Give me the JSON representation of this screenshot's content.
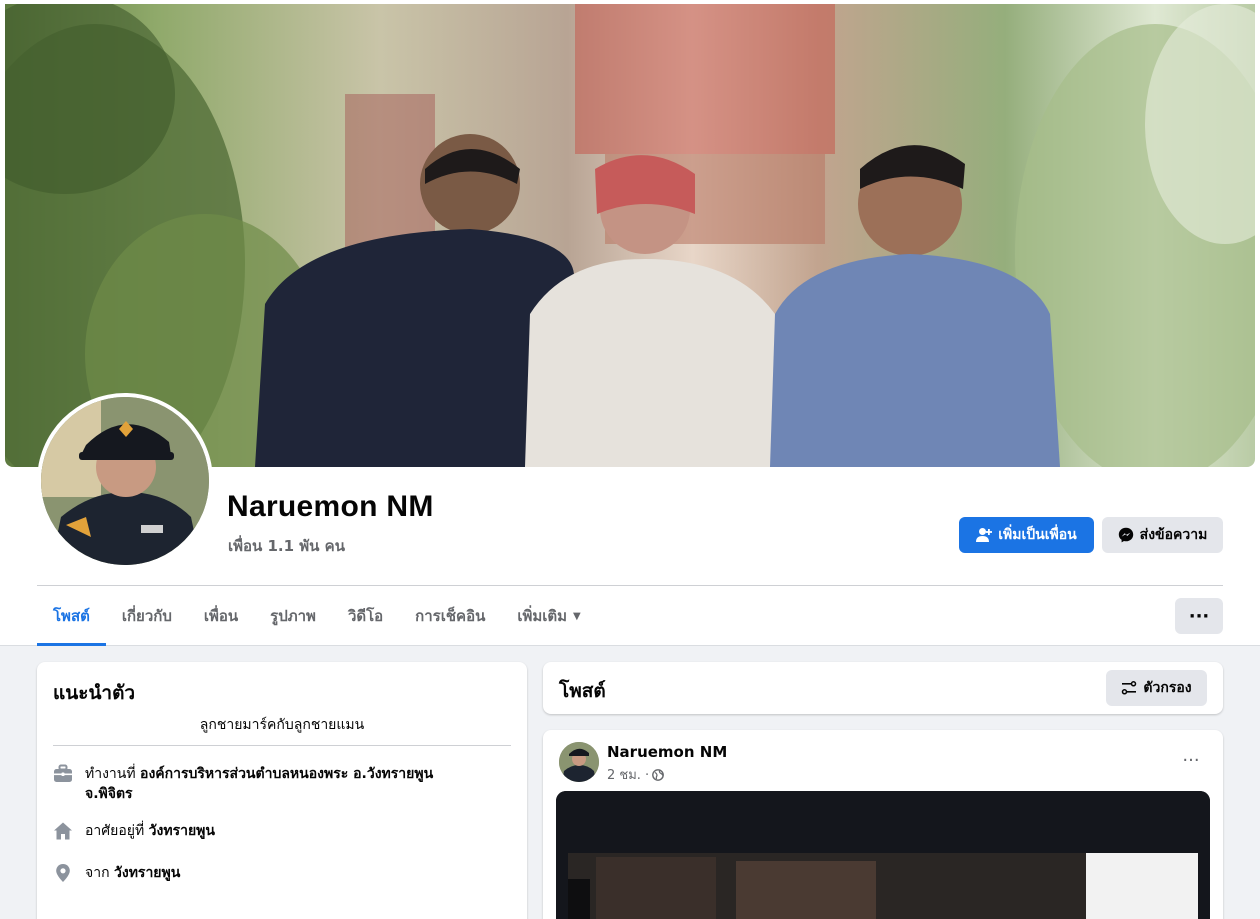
{
  "profile": {
    "name": "Naruemon NM",
    "friends_count": "เพื่อน 1.1 พัน คน"
  },
  "actions": {
    "add_friend": "เพิ่มเป็นเพื่อน",
    "message": "ส่งข้อความ",
    "more": "···"
  },
  "tabs": [
    {
      "label": "โพสต์",
      "active": true
    },
    {
      "label": "เกี่ยวกับ",
      "active": false
    },
    {
      "label": "เพื่อน",
      "active": false
    },
    {
      "label": "รูปภาพ",
      "active": false
    },
    {
      "label": "วิดีโอ",
      "active": false
    },
    {
      "label": "การเช็คอิน",
      "active": false
    },
    {
      "label": "เพิ่มเติม",
      "active": false
    }
  ],
  "intro": {
    "title": "แนะนำตัว",
    "bio": "ลูกชายมาร์คกับลูกชายแมน",
    "work_prefix": "ทำงานที่",
    "work_place": "องค์การบริหารส่วนตำบลหนองพระ อ.วังทรายพูน จ.พิจิตร",
    "lives_prefix": "อาศัยอยู่ที่",
    "lives_place": "วังทรายพูน",
    "from_prefix": "จาก",
    "from_place": "วังทรายพูน"
  },
  "posts": {
    "title": "โพสต์",
    "filter_label": "ตัวกรอง",
    "items": [
      {
        "author": "Naruemon NM",
        "time": "2 ชม. ·",
        "more": "···"
      }
    ]
  },
  "colors": {
    "accent": "#1b74e4",
    "secondary_button": "#e4e6eb",
    "muted_text": "#65676b"
  }
}
